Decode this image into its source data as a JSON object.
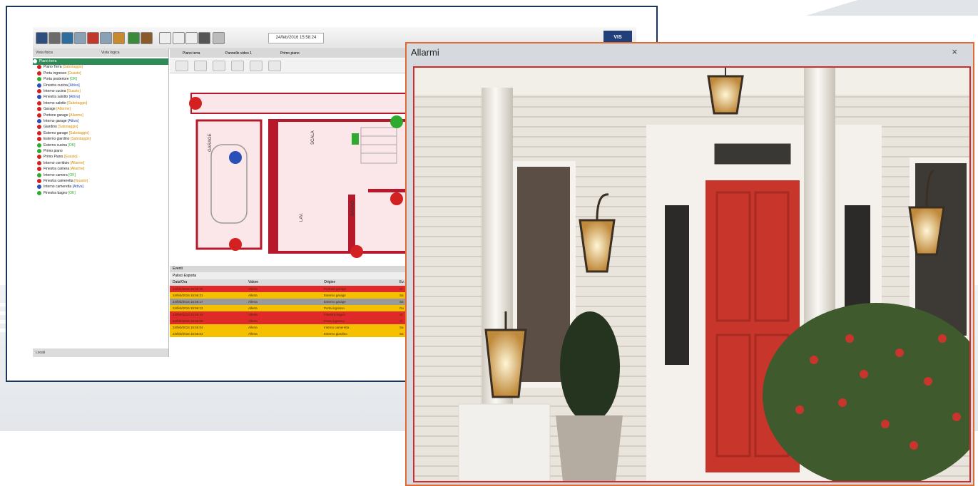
{
  "app": {
    "datetime": "24/feb/2016 15:58:24",
    "logo_text": "VIS",
    "toolbar_icons": [
      "vehicle-icon",
      "grid-icon",
      "tree-icon",
      "panel-icon",
      "alarm-icon",
      "panel-icon",
      "figure-icon",
      "users-icon",
      "camera-icon",
      "window-icon",
      "window-icon",
      "window-icon",
      "refresh-icon",
      "print-icon"
    ],
    "left_tabs": [
      "Vista fisica",
      "Vista logica"
    ],
    "left_footer": "Locali",
    "tree": [
      {
        "label": "Piano terra",
        "status": "",
        "color": "#ffffff",
        "selected": true
      },
      {
        "label": "Piano Terra",
        "status": "[Sabotaggio]",
        "color": "#d32020"
      },
      {
        "label": "Porta ingresso",
        "status": "[Guasto]",
        "color": "#d32020"
      },
      {
        "label": "Porta posteriore",
        "status": "[OK]",
        "color": "#2eaa2e"
      },
      {
        "label": "Finestra cucina",
        "status": "[Attiva]",
        "color": "#2a4fb8"
      },
      {
        "label": "Interno cucina",
        "status": "[Guasto]",
        "color": "#d32020"
      },
      {
        "label": "Finestra salotto",
        "status": "[Attiva]",
        "color": "#2a4fb8"
      },
      {
        "label": "Interno salotto",
        "status": "[Sabotaggio]",
        "color": "#d32020"
      },
      {
        "label": "Garage",
        "status": "[Allarme]",
        "color": "#d32020"
      },
      {
        "label": "Portone garage",
        "status": "[Allarme]",
        "color": "#d32020"
      },
      {
        "label": "Interno garage",
        "status": "[Attiva]",
        "color": "#2a4fb8"
      },
      {
        "label": "Giardino",
        "status": "[Sabotaggio]",
        "color": "#d32020"
      },
      {
        "label": "Esterno garage",
        "status": "[Sabotaggio]",
        "color": "#d32020"
      },
      {
        "label": "Esterno giardino",
        "status": "[Sabotaggio]",
        "color": "#d32020"
      },
      {
        "label": "Esterno cucina",
        "status": "[OK]",
        "color": "#2eaa2e"
      },
      {
        "label": "Primo piano",
        "status": "",
        "color": "#2eaa2e"
      },
      {
        "label": "Primo Piano",
        "status": "[Guasto]",
        "color": "#d32020"
      },
      {
        "label": "Interno corridoio",
        "status": "[Allarme]",
        "color": "#d32020"
      },
      {
        "label": "Finestra camera",
        "status": "[Allarme]",
        "color": "#d32020"
      },
      {
        "label": "Interno camera",
        "status": "[OK]",
        "color": "#2eaa2e"
      },
      {
        "label": "Finestra cameretta",
        "status": "[Guasto]",
        "color": "#d32020"
      },
      {
        "label": "Interno cameretta",
        "status": "[Attiva]",
        "color": "#2a4fb8"
      },
      {
        "label": "Finestra bagno",
        "status": "[OK]",
        "color": "#2eaa2e"
      }
    ],
    "center_tabs": [
      "Piano terra",
      "Pannello video 1",
      "Primo piano"
    ],
    "floorplan_labels": [
      "GARAGE",
      "SCALA",
      "LAV.",
      "BAGNO"
    ],
    "floorplan_sensors": [
      {
        "color": "#d32020"
      },
      {
        "color": "#2eaa2e"
      },
      {
        "color": "#2a4fb8"
      },
      {
        "color": "#d32020"
      },
      {
        "color": "#d32020"
      },
      {
        "color": "#d32020"
      },
      {
        "color": "#2a4fb8"
      }
    ],
    "events": {
      "title": "Eventi",
      "toolbar": "Pulisci  Esporta",
      "columns": [
        "Data/Ora",
        "Valore",
        "Origine",
        "Ev."
      ],
      "rows": [
        {
          "datetime": "24/feb/2016 15:56:25",
          "value": "Allerta",
          "origin": "Portone garage",
          "ev": "Al",
          "color": "#e02a2a"
        },
        {
          "datetime": "24/feb/2016 15:56:21",
          "value": "Allerta",
          "origin": "Esterno garage",
          "ev": "Sa",
          "color": "#f5c000"
        },
        {
          "datetime": "24/feb/2016 15:56:17",
          "value": "Allerta",
          "origin": "Esterno garage",
          "ev": "Sa",
          "color": "#9a9a9a"
        },
        {
          "datetime": "24/feb/2016 15:56:13",
          "value": "Allerta",
          "origin": "Porta ingresso",
          "ev": "Gu",
          "color": "#f5c000"
        },
        {
          "datetime": "24/feb/2016 15:56:10",
          "value": "Allerta",
          "origin": "Finestra bagno",
          "ev": "Al",
          "color": "#e02a2a"
        },
        {
          "datetime": "24/feb/2016 15:56:09",
          "value": "Allerta",
          "origin": "Porta ingresso",
          "ev": "Al",
          "color": "#e02a2a"
        },
        {
          "datetime": "24/feb/2016 15:56:04",
          "value": "Allerta",
          "origin": "Interno cameretta",
          "ev": "Sa",
          "color": "#f5c000"
        },
        {
          "datetime": "24/feb/2016 15:56:04",
          "value": "Allerta",
          "origin": "Esterno giardino",
          "ev": "Sa",
          "color": "#f5c000"
        }
      ]
    }
  },
  "alarm_window": {
    "title": "Allarmi",
    "close_label": "×",
    "border_color": "#e06a32",
    "image_border_color": "#d22b2b"
  }
}
